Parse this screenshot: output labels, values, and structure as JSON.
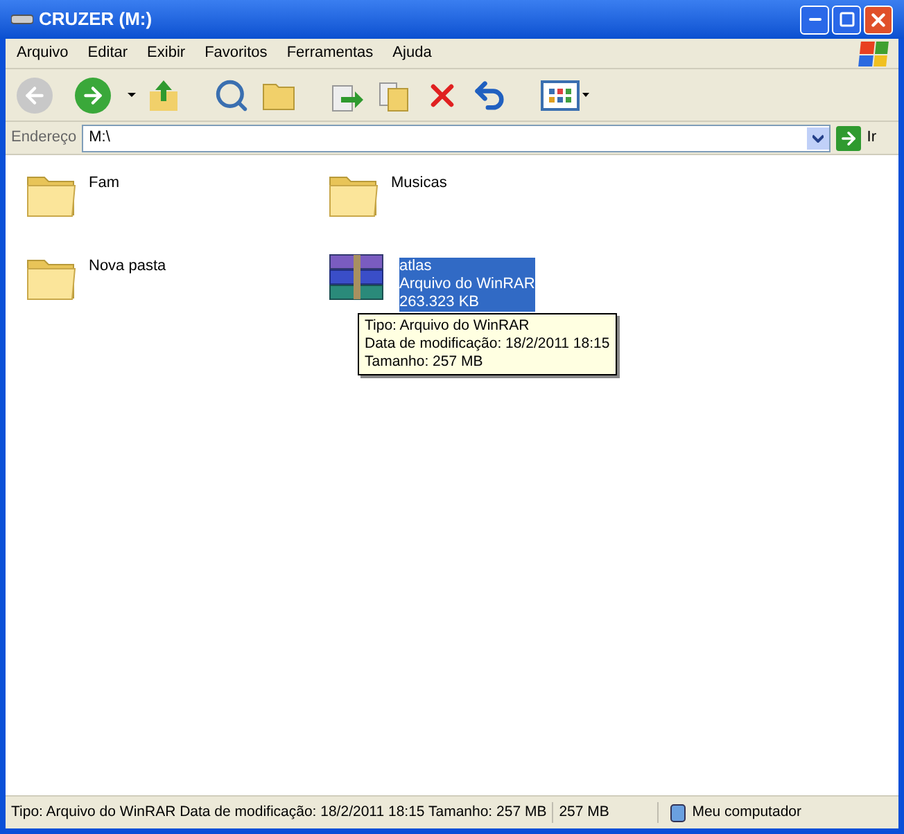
{
  "window": {
    "title": "CRUZER (M:)"
  },
  "menu": [
    "Arquivo",
    "Editar",
    "Exibir",
    "Favoritos",
    "Ferramentas",
    "Ajuda"
  ],
  "toolbar": [
    {
      "kind": "back",
      "disabled": true
    },
    {
      "kind": "forward",
      "disabled": false
    },
    {
      "kind": "up",
      "disabled": false
    },
    {
      "kind": "search",
      "disabled": false
    },
    {
      "kind": "folders",
      "disabled": false
    },
    {
      "kind": "move",
      "disabled": false
    },
    {
      "kind": "copy",
      "disabled": false
    },
    {
      "kind": "delete",
      "disabled": false
    },
    {
      "kind": "undo",
      "disabled": false
    },
    {
      "kind": "views",
      "disabled": false
    }
  ],
  "address": {
    "label": "Endereço",
    "value": "M:\\",
    "go": "Ir"
  },
  "items": [
    {
      "kind": "folder",
      "name": "Fam",
      "selected": false
    },
    {
      "kind": "folder",
      "name": "Musicas",
      "selected": false
    },
    {
      "kind": "folder",
      "name": "Nova pasta",
      "selected": false
    },
    {
      "kind": "archive",
      "name": "atlas",
      "type": "Arquivo do WinRAR",
      "size": "263.323 KB",
      "selected": true
    }
  ],
  "tooltip": [
    "Tipo: Arquivo do WinRAR",
    "Data de modificação: 18/2/2011 18:15",
    "Tamanho: 257 MB"
  ],
  "status_bar": {
    "details": "Tipo: Arquivo do WinRAR Data de modificação: 18/2/2011 18:15 Tamanho: 257 MB",
    "size": "257 MB",
    "zone": "Meu computador"
  }
}
